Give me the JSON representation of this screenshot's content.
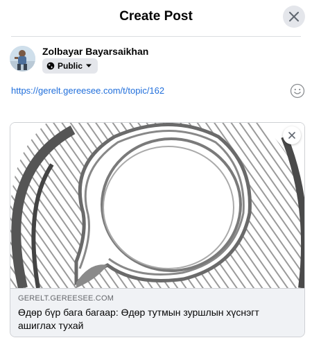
{
  "dialog": {
    "title": "Create Post"
  },
  "author": {
    "name": "Zolbayar Bayarsaikhan",
    "audience": "Public"
  },
  "composer": {
    "text": "https://gerelt.gereesee.com/t/topic/162"
  },
  "link_preview": {
    "domain": "GERELT.GEREESEE.COM",
    "title": "Өдөр бүр бага багаар: Өдөр тутмын зуршлын хүснэгт ашиглах тухай"
  },
  "icons": {
    "close": "close-icon",
    "globe": "globe-icon",
    "caret": "caret-down-icon",
    "emoji": "emoji-icon",
    "preview_close": "close-icon"
  },
  "colors": {
    "link": "#216fdb",
    "button_bg": "#e4e6eb",
    "preview_bg": "#f0f2f5"
  }
}
